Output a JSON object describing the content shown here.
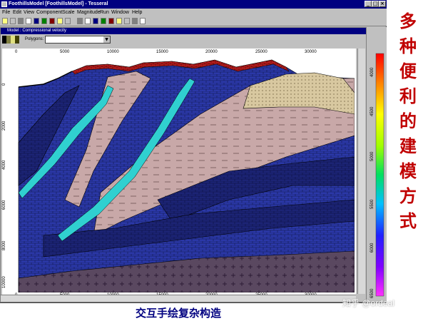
{
  "window": {
    "title": "FoothillsModel [FoothillsModel] - Tesseral",
    "controls": [
      "_",
      "□",
      "×"
    ]
  },
  "menu": [
    "File",
    "Edit",
    "View",
    "Component",
    "Scale",
    "Magnitude",
    "Run",
    "Window",
    "Help"
  ],
  "toolbar_icons": [
    "new-icon",
    "open-icon",
    "save-icon",
    "print-icon",
    "copy-icon",
    "cut-icon",
    "paste-icon",
    "undo-icon",
    "redo-icon",
    "zoom-in-icon",
    "zoom-out-icon",
    "pointer-icon",
    "select-icon",
    "pen-icon",
    "node-icon",
    "cut-tool-icon",
    "delete-icon",
    "help-icon"
  ],
  "model": {
    "subtitle": "Model : Compressional velocity",
    "polygons_label": "Polygons:",
    "polygons_value": "",
    "x_ticks": [
      "0",
      "5000",
      "10000",
      "15000",
      "20000",
      "25000",
      "30000"
    ],
    "y_ticks": [
      "0",
      "2000",
      "4000",
      "6000",
      "8000",
      "10000"
    ]
  },
  "colorbar": {
    "ticks": [
      "4000",
      "4500",
      "5000",
      "5500",
      "6000",
      "6500"
    ],
    "colors": [
      "#ff30ff",
      "#8000ff",
      "#2020ff",
      "#00c0ff",
      "#00e060",
      "#a0ff00",
      "#ffff00",
      "#ff8000",
      "#ff0000"
    ]
  },
  "colors": {
    "layer_blue": "#2b38a8",
    "layer_dark_blue": "#1c2475",
    "layer_pink": "#c8a8a8",
    "layer_cyan": "#30d0d0",
    "layer_tan": "#d8c8a0",
    "basement": "#5a4860",
    "thrust_top": "#c02020"
  },
  "side_title": [
    "多",
    "种",
    "便",
    "利",
    "的",
    "建",
    "模",
    "方",
    "式"
  ],
  "caption": "交互手绘复杂构造",
  "watermark": "知乎 @ordeal"
}
